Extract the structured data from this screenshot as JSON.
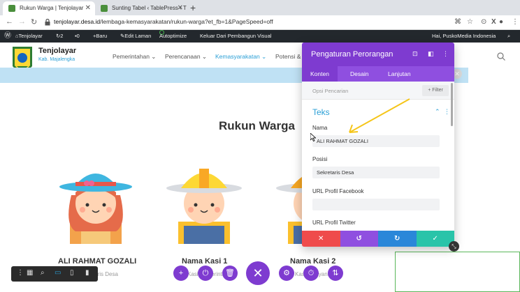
{
  "browser": {
    "tabs": [
      {
        "title": "Rukun Warga | Tenjolayar",
        "active": true
      },
      {
        "title": "Sunting Tabel ‹ TablePress ‹ T",
        "active": false
      }
    ],
    "url_host": "tenjolayar.desa.id",
    "url_path": "/lembaga-kemasyarakatan/rukun-warga?et_fb=1&PageSpeed=off"
  },
  "wpbar": {
    "site": "Tenjolayar",
    "updates": "2",
    "comments": "0",
    "new": "Baru",
    "edit": "Edit Laman",
    "autoptimize": "Autoptimize",
    "exit_builder": "Keluar Dari Pembangun Visual",
    "greeting": "Hai, PuskoMedia Indonesia"
  },
  "site": {
    "brand": "Tenjolayar",
    "brand_sub": "Kab. Majalengka",
    "menu": [
      {
        "label": "Pemerintahan ⌄"
      },
      {
        "label": "Perencanaan ⌄"
      },
      {
        "label": "Kemasyarakatan ⌄"
      },
      {
        "label": "Potensi &"
      }
    ]
  },
  "page": {
    "title": "Rukun Warga",
    "people": [
      {
        "name": "ALI RAHMAT GOZALI",
        "role": "Sekretaris Desa"
      },
      {
        "name": "Nama Kasi 1",
        "role": "Kasi Pemerintahan"
      },
      {
        "name": "Nama Kasi 2",
        "role": "Kasi Pelayanan"
      }
    ]
  },
  "modal": {
    "title": "Pengaturan Perorangan",
    "tabs": [
      "Konten",
      "Desain",
      "Lanjutan"
    ],
    "search_placeholder": "Opsi Pencarian",
    "filter_label": "+ Filter",
    "section_title": "Teks",
    "fields": [
      {
        "label": "Nama",
        "value": "ALI RAHMAT GOZALI"
      },
      {
        "label": "Posisi",
        "value": "Sekretaris Desa"
      },
      {
        "label": "URL Profil Facebook",
        "value": ""
      },
      {
        "label": "URL Profil Twitter",
        "value": ""
      }
    ]
  },
  "colors": {
    "divi_purple": "#7e3bd0",
    "cancel_red": "#ef4b4b",
    "undo_purple": "#8f4fe0",
    "redo_blue": "#2a87d9",
    "save_green": "#29c4a9",
    "accent_blue": "#2a9fd6"
  }
}
